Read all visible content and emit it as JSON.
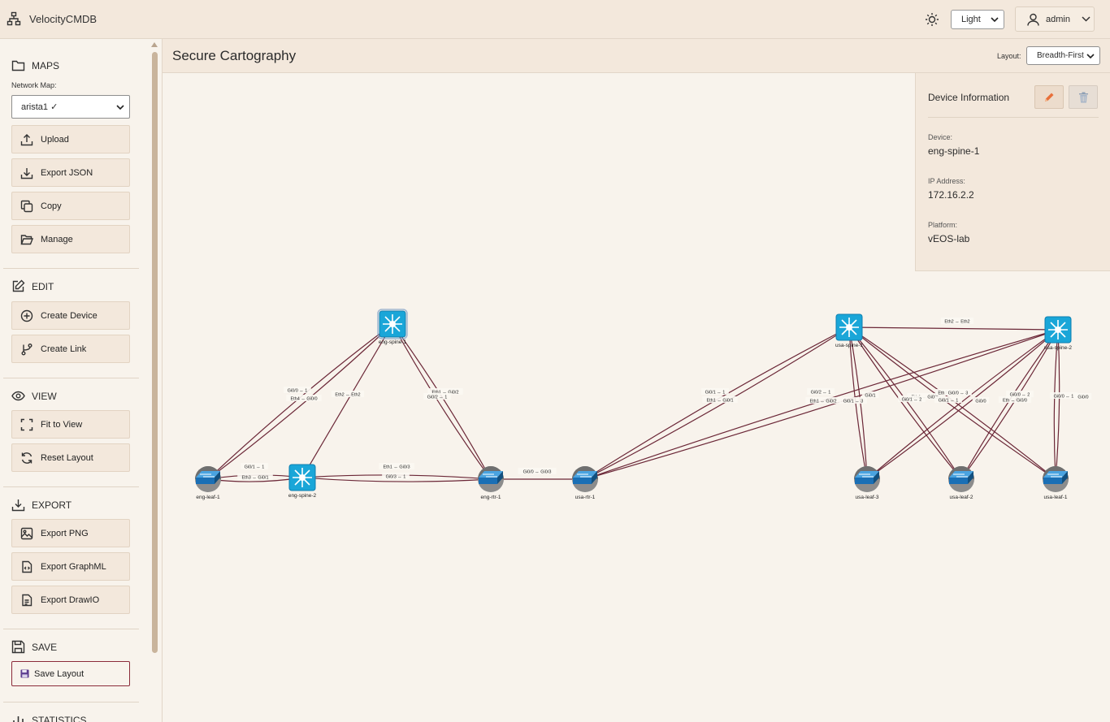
{
  "app": {
    "title": "VelocityCMDB"
  },
  "topbar": {
    "theme_value": "Light",
    "user_name": "admin"
  },
  "sidebar": {
    "maps": {
      "heading": "MAPS",
      "network_map_label": "Network Map:",
      "network_map_value": "arista1 ✓",
      "buttons": [
        "Upload",
        "Export JSON",
        "Copy",
        "Manage"
      ]
    },
    "edit": {
      "heading": "EDIT",
      "buttons": [
        "Create Device",
        "Create Link"
      ]
    },
    "view": {
      "heading": "VIEW",
      "buttons": [
        "Fit to View",
        "Reset Layout"
      ]
    },
    "export": {
      "heading": "EXPORT",
      "buttons": [
        "Export PNG",
        "Export GraphML",
        "Export DrawIO"
      ]
    },
    "save": {
      "heading": "SAVE",
      "button": "Save Layout"
    },
    "statistics": {
      "heading": "STATISTICS"
    }
  },
  "main": {
    "title": "Secure Cartography",
    "layout_label": "Layout:",
    "layout_value": "Breadth-First"
  },
  "device_info": {
    "title": "Device Information",
    "device_label": "Device:",
    "device_value": "eng-spine-1",
    "ip_label": "IP Address:",
    "ip_value": "172.16.2.2",
    "platform_label": "Platform:",
    "platform_value": "vEOS-lab"
  },
  "colors": {
    "link": "#6b2737",
    "switch": "#1aa6d8",
    "router": "#1a6fb5",
    "accent": "#e8703a"
  },
  "topology": {
    "nodes": [
      {
        "id": "eng-spine-1",
        "label": "eng-spine-1",
        "kind": "switch"
      },
      {
        "id": "eng-spine-2",
        "label": "eng-spine-2",
        "kind": "switch"
      },
      {
        "id": "eng-leaf-1",
        "label": "eng-leaf-1",
        "kind": "router"
      },
      {
        "id": "eng-rtr-1",
        "label": "eng-rtr-1",
        "kind": "router"
      },
      {
        "id": "usa-rtr-1",
        "label": "usa-rtr-1",
        "kind": "router"
      },
      {
        "id": "usa-spine-1",
        "label": "usa-spine-1",
        "kind": "switch"
      },
      {
        "id": "usa-spine-2",
        "label": "usa-spine-2",
        "kind": "switch"
      },
      {
        "id": "usa-leaf-3",
        "label": "usa-leaf-3",
        "kind": "router"
      },
      {
        "id": "usa-leaf-2",
        "label": "usa-leaf-2",
        "kind": "router"
      },
      {
        "id": "usa-leaf-1",
        "label": "usa-leaf-1",
        "kind": "router"
      }
    ],
    "edge_labels": [
      "Gi0/0 ↔ 1",
      "Eth4 ↔ Gi0/0",
      "Eth2 ↔ Eth2",
      "Eth1 ↔ Gi0/2",
      "Gi0/2 ↔ 1",
      "Gi0/1 ↔ 1",
      "Eth3 ↔ Gi0/1",
      "Eth1 ↔ Gi0/3",
      "Gi0/3 ↔ 1",
      "Gi0/0 ↔ Gi0/3",
      "Gi0/1 ↔ 1",
      "Eth1 ↔ Gi0/1",
      "Gi0/2 ↔ 1",
      "Eth1 ↔ Gi0/2",
      "Gi0/1 ↔ 3",
      "Gi0/1",
      "Eth2 ↔ Eth2",
      "Eth4 ↔ Gi0/1",
      "Gi0/1 ↔ 2",
      "Eth1",
      "Gi0/0 ↔ 3",
      "Gi0/1 ↔ 1",
      "Gi0/0",
      "Gi0/0 ↔ 2",
      "Eth ↔ Gi0/0",
      "Gi0/0 ↔ 1",
      "Gi0/0"
    ]
  }
}
